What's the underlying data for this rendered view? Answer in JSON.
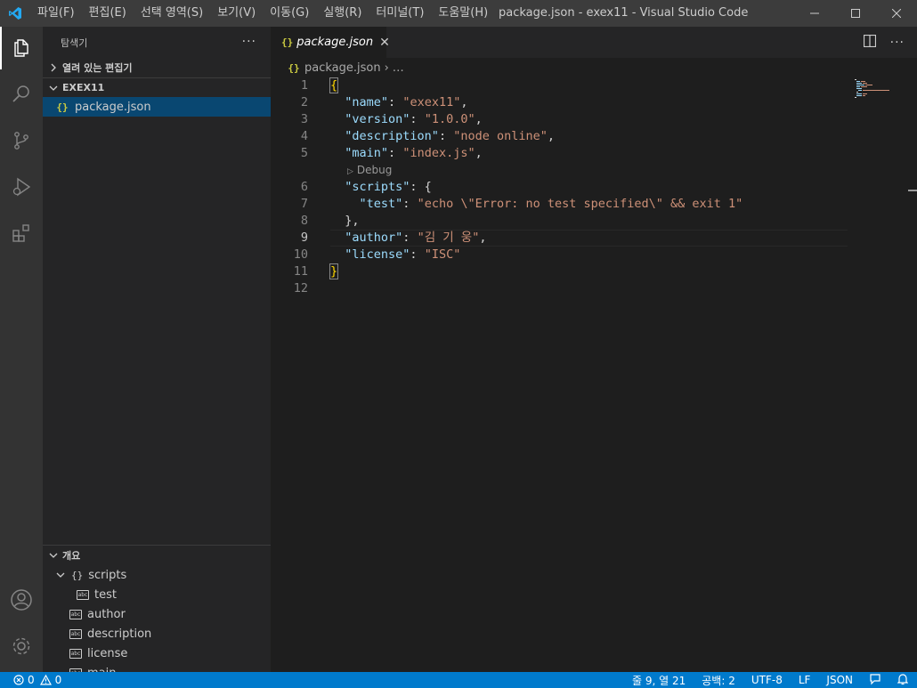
{
  "titlebar": {
    "menu": [
      "파일(F)",
      "편집(E)",
      "선택 영역(S)",
      "보기(V)",
      "이동(G)",
      "실행(R)",
      "터미널(T)",
      "도움말(H)"
    ],
    "window_title": "package.json - exex11 - Visual Studio Code"
  },
  "sidebar": {
    "header": "탐색기",
    "more": "···",
    "open_editors": "열려 있는 편집기",
    "folder": "EXEX11",
    "file": "package.json",
    "outline": {
      "header": "개요",
      "scripts": "scripts",
      "test": "test",
      "author": "author",
      "description": "description",
      "license": "license",
      "main": "main"
    }
  },
  "editor": {
    "tab_label": "package.json",
    "breadcrumb_file": "package.json",
    "breadcrumb_more": "…",
    "codelens": "Debug",
    "line_numbers": [
      "1",
      "2",
      "3",
      "4",
      "5",
      "6",
      "7",
      "8",
      "9",
      "10",
      "11",
      "12"
    ],
    "keys": {
      "name": "\"name\"",
      "version": "\"version\"",
      "description": "\"description\"",
      "main": "\"main\"",
      "scripts": "\"scripts\"",
      "test": "\"test\"",
      "author": "\"author\"",
      "license": "\"license\""
    },
    "values": {
      "name": "\"exex11\"",
      "version": "\"1.0.0\"",
      "description": "\"node online\"",
      "main": "\"index.js\"",
      "test": "\"echo \\\"Error: no test specified\\\" && exit 1\"",
      "author": "\"김 기 웅\"",
      "license": "\"ISC\""
    }
  },
  "statusbar": {
    "errors": "0",
    "warnings": "0",
    "position": "줄 9, 열 21",
    "indent": "공백: 2",
    "encoding": "UTF-8",
    "eol": "LF",
    "language": "JSON"
  }
}
